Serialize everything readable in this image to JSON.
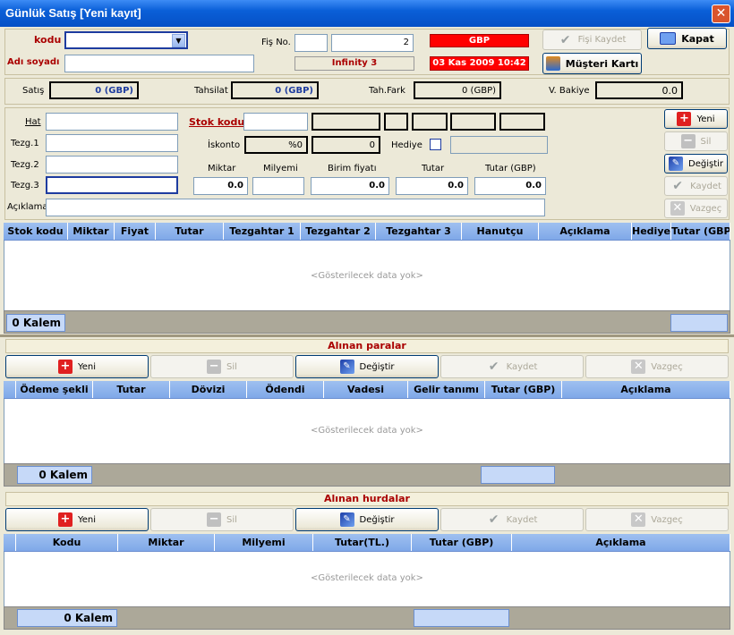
{
  "window": {
    "title": "Günlük Satış [Yeni kayıt]",
    "close_glyph": "✕"
  },
  "header": {
    "kodu_label": "kodu",
    "adi_label": "Adı soyadı",
    "fis_label": "Fiş No.",
    "fis_no": "2",
    "currency": "GBP",
    "company": "Infinity 3",
    "datetime": "03 Kas 2009 10:42",
    "fisi_kaydet": "Fişi Kaydet",
    "kapat": "Kapat",
    "musteri_karti": "Müşteri Kartı"
  },
  "summary": {
    "satis_label": "Satış",
    "satis": "0 (GBP)",
    "tahsilat_label": "Tahsilat",
    "tahsilat": "0 (GBP)",
    "tahfark_label": "Tah.Fark",
    "tahfark": "0 (GBP)",
    "vbakiye_label": "V. Bakiye",
    "vbakiye": "0.0"
  },
  "entry": {
    "hat": "Hat",
    "tezg1": "Tezg.1",
    "tezg2": "Tezg.2",
    "tezg3": "Tezg.3",
    "aciklama": "Açıklama",
    "stok_kodu": "Stok kodu",
    "iskonto": "İskonto",
    "iskonto_pct": "%0",
    "iskonto_val": "0",
    "hediye": "Hediye",
    "miktar_label": "Miktar",
    "milyemi_label": "Milyemi",
    "birim_label": "Birim fiyatı",
    "tutar_label": "Tutar",
    "tutar_gbp_label": "Tutar (GBP)",
    "miktar": "0.0",
    "birim": "0.0",
    "tutar": "0.0",
    "tutar_gbp": "0.0",
    "yeni": "Yeni",
    "sil": "Sil",
    "degistir": "Değiştir",
    "kaydet": "Kaydet",
    "vazgec": "Vazgeç"
  },
  "grid1": {
    "columns": [
      "Stok kodu",
      "Miktar",
      "Fiyat",
      "Tutar",
      "Tezgahtar 1",
      "Tezgahtar 2",
      "Tezgahtar 3",
      "Hanutçu",
      "Açıklama",
      "Hediye",
      "Tutar (GBP)"
    ],
    "empty": "<Gösterilecek data yok>",
    "kalem": "0 Kalem"
  },
  "payments": {
    "title": "Alınan paralar",
    "yeni": "Yeni",
    "sil": "Sil",
    "degistir": "Değiştir",
    "kaydet": "Kaydet",
    "vazgec": "Vazgeç",
    "columns": [
      "Ödeme şekli",
      "Tutar",
      "Dövizi",
      "Ödendi",
      "Vadesi",
      "Gelir tanımı",
      "Tutar (GBP)",
      "Açıklama"
    ],
    "empty": "<Gösterilecek data yok>",
    "kalem": "0 Kalem"
  },
  "scrap": {
    "title": "Alınan hurdalar",
    "yeni": "Yeni",
    "sil": "Sil",
    "degistir": "Değiştir",
    "kaydet": "Kaydet",
    "vazgec": "Vazgeç",
    "columns": [
      "Kodu",
      "Miktar",
      "Milyemi",
      "Tutar(TL.)",
      "Tutar (GBP)",
      "Açıklama"
    ],
    "empty": "<Gösterilecek data yok>",
    "kalem": "0 Kalem"
  },
  "colors": {
    "accent": "#0a5fd8",
    "currency_bg": "#ff0000",
    "grid_header": "#9fc0f0"
  }
}
